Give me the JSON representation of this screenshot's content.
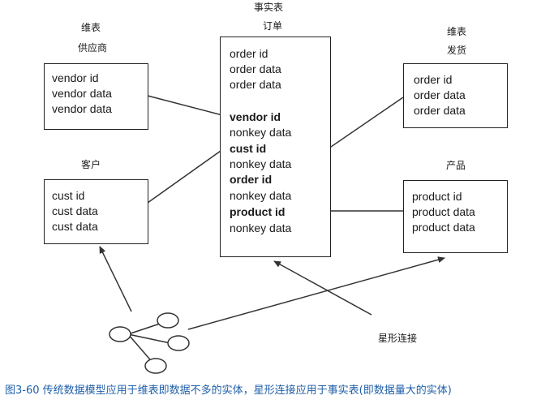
{
  "labels": {
    "vendor_dim_tag": "维表",
    "vendor_name": "供应商",
    "fact_tag": "事实表",
    "fact_name": "订单",
    "ship_dim_tag": "维表",
    "ship_name": "发货",
    "customer_name": "客户",
    "product_name": "产品",
    "star_join": "星形连接"
  },
  "vendor_box": [
    "vendor id",
    "vendor data",
    "vendor data"
  ],
  "customer_box": [
    "cust id",
    "cust data",
    "cust data"
  ],
  "ship_box": [
    "order id",
    "order data",
    "order data"
  ],
  "product_box": [
    "product id",
    "product data",
    "product data"
  ],
  "fact_box": [
    "order id",
    "order data",
    "order data",
    "vendor id",
    "nonkey data",
    "cust id",
    "nonkey data",
    "order id",
    "nonkey data",
    "product id",
    "nonkey data"
  ],
  "caption": "图3-60   传统数据模型应用于维表即数据不多的实体，星形连接应用于事实表(即数据量大的实体)",
  "colors": {
    "caption": "#1f5fa8",
    "lines": "#333333"
  }
}
